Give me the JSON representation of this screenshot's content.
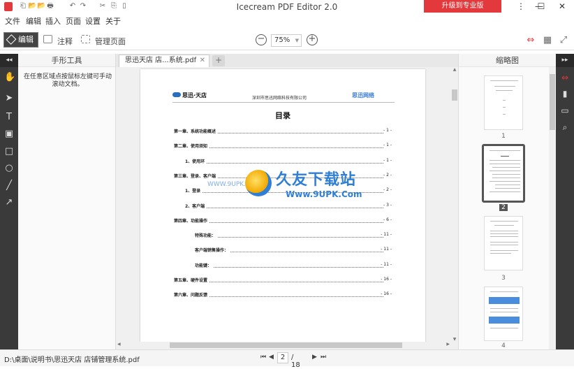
{
  "app": {
    "title": "Icecream PDF Editor 2.0",
    "upgrade_label": "升级到专业版",
    "accent_color": "#e4393c"
  },
  "window_controls": [
    "⋮",
    "—",
    "☐",
    "✕"
  ],
  "quick_access": [
    "⎗",
    "📂",
    "🖶",
    "↶",
    "↷",
    "✂",
    "⎘",
    "▯"
  ],
  "menu": [
    "文件",
    "编辑",
    "插入",
    "页面",
    "设置",
    "关于"
  ],
  "toolbar": {
    "edit_label": "编辑",
    "annotate_label": "注释",
    "manage_pages_label": "管理页面",
    "zoom_out": "−",
    "zoom_value": "75%",
    "zoom_in": "+"
  },
  "left_panel": {
    "collapse": "◂◂",
    "title": "手形工具",
    "hint": "在任意区域点按鼠标左键可手动滚动文档。"
  },
  "tab": {
    "name": "思迅天店 店...系统.pdf",
    "close": "✕",
    "add": "+"
  },
  "document": {
    "logo_left": "思迅·天店",
    "company": "深圳市思迅网络科技有限公司",
    "logo_right": "思迅网络",
    "title": "目录",
    "toc": [
      {
        "text": "第一章、系统功能概述",
        "page": "- 1 -",
        "indent": 0
      },
      {
        "text": "第二章、使用须知",
        "page": "- 1 -",
        "indent": 0
      },
      {
        "text": "1、使用环",
        "page": "- 1 -",
        "indent": 1
      },
      {
        "text": "第三章、登录、客户端",
        "page": "- 2 -",
        "indent": 0
      },
      {
        "text": "1、登录",
        "page": "- 2 -",
        "indent": 1
      },
      {
        "text": "2、客户端",
        "page": "- 3 -",
        "indent": 1
      },
      {
        "text": "第四章、功能操作",
        "page": "- 6 -",
        "indent": 0
      },
      {
        "text": "特殊功能：",
        "page": "- 11 -",
        "indent": 2
      },
      {
        "text": "客户端销售操作：",
        "page": "- 11 -",
        "indent": 2
      },
      {
        "text": "功能键：",
        "page": "- 11 -",
        "indent": 2
      },
      {
        "text": "第五章、硬件设置",
        "page": "- 16 -",
        "indent": 0
      },
      {
        "text": "第六章、问题反馈",
        "page": "- 16 -",
        "indent": 0
      }
    ],
    "watermark_text": "久友下载站",
    "watermark_url": "Www.9UPK.Com",
    "watermark_url_left": "WWW.9UPK.COM"
  },
  "thumbnails": {
    "title": "缩略图",
    "expand": "▸▸",
    "pages": [
      "1",
      "2",
      "3",
      "4"
    ],
    "selected": "2"
  },
  "right_strip_icons": [
    "pages-icon",
    "bookmark-icon",
    "comment-icon",
    "search-icon"
  ],
  "status": {
    "path": "D:\\桌面\\说明书\\思迅天店 店铺管理系统.pdf",
    "current_page": "2",
    "total_pages": "/ 18",
    "first": "⏮",
    "prev": "◀",
    "next": "▶",
    "last": "⏭"
  }
}
